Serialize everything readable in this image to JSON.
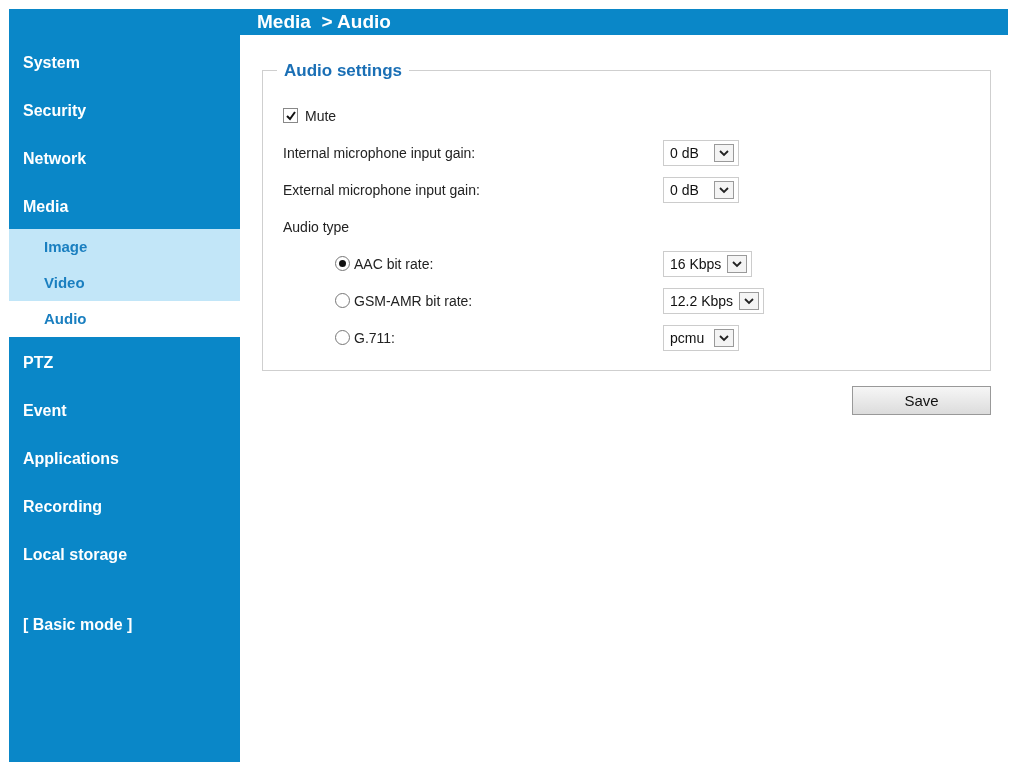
{
  "header": {
    "title": "Media  > Audio"
  },
  "sidebar": {
    "items": [
      {
        "label": "System",
        "kind": "menu",
        "selected": false
      },
      {
        "label": "Security",
        "kind": "menu",
        "selected": false
      },
      {
        "label": "Network",
        "kind": "menu",
        "selected": false
      },
      {
        "label": "Media",
        "kind": "menu",
        "selected": false,
        "expanded": true,
        "children": [
          {
            "label": "Image",
            "selected": false
          },
          {
            "label": "Video",
            "selected": false
          },
          {
            "label": "Audio",
            "selected": true
          }
        ]
      },
      {
        "label": "PTZ",
        "kind": "menu",
        "selected": false
      },
      {
        "label": "Event",
        "kind": "menu",
        "selected": false
      },
      {
        "label": "Applications",
        "kind": "menu",
        "selected": false
      },
      {
        "label": "Recording",
        "kind": "menu",
        "selected": false
      },
      {
        "label": "Local storage",
        "kind": "menu",
        "selected": false
      },
      {
        "label": "[ Basic mode ]",
        "kind": "mode",
        "selected": false
      }
    ]
  },
  "audio_settings": {
    "title": "Audio settings",
    "rows": [
      {
        "kind": "checkbox",
        "label": "Mute",
        "checked": true
      },
      {
        "kind": "select",
        "label": "Internal microphone input gain:",
        "value": "0 dB"
      },
      {
        "kind": "select",
        "label": "External microphone input gain:",
        "value": "0 dB"
      },
      {
        "kind": "heading",
        "label": "Audio type"
      },
      {
        "kind": "radio",
        "label": "AAC bit rate:",
        "selected": true,
        "value": "16 Kbps"
      },
      {
        "kind": "radio",
        "label": "GSM-AMR bit rate:",
        "selected": false,
        "value": "12.2 Kbps"
      },
      {
        "kind": "radio",
        "label": "G.711:",
        "selected": false,
        "value": "pcmu"
      }
    ]
  },
  "buttons": [
    {
      "label": "Save"
    }
  ]
}
